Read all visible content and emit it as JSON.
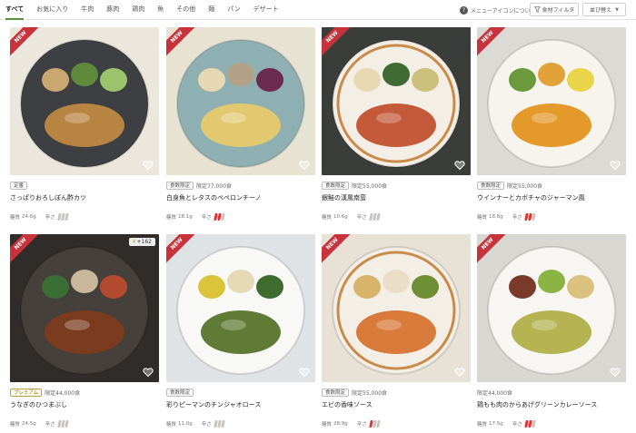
{
  "filters": {
    "tabs": [
      "すべて",
      "お気に入り",
      "牛肉",
      "豚肉",
      "鶏肉",
      "魚",
      "その他",
      "麺",
      "パン",
      "デザート"
    ],
    "active_tab": "すべて",
    "help_text": "メニューアイコンについて",
    "filter_button": "食材フィルタ",
    "sort_button": "並び替え"
  },
  "labels": {
    "carb_prefix": "糖質",
    "spice_label": "辛さ",
    "new_ribbon": "NEW"
  },
  "products": [
    {
      "name": "さっぱりおろしぽん酢カツ",
      "badge": "定番",
      "badge_type": "normal",
      "limit": "",
      "carbs": "24.6g",
      "spice_level": 0,
      "is_new": true,
      "price": "",
      "bg": "#ece7dc",
      "plate": "#3d3f42"
    },
    {
      "name": "白身魚とレタスのペペロンチーノ",
      "badge": "食数限定",
      "badge_type": "normal",
      "limit": "限定77,000食",
      "carbs": "18.1g",
      "spice_level": 2,
      "is_new": true,
      "price": "",
      "bg": "#e8e2d3",
      "plate": "#8fb0b2"
    },
    {
      "name": "銀鮭の漢風南蛮",
      "badge": "食数限定",
      "badge_type": "normal",
      "limit": "限定55,000食",
      "carbs": "10.6g",
      "spice_level": 0,
      "is_new": true,
      "price": "",
      "bg": "#3b3d3a",
      "plate": "#f3efe6"
    },
    {
      "name": "ウインナーとカボチャのジャーマン風",
      "badge": "食数限定",
      "badge_type": "normal",
      "limit": "限定55,000食",
      "carbs": "18.8g",
      "spice_level": 2,
      "is_new": true,
      "price": "",
      "bg": "#dbdad4",
      "plate": "#f6f4ec"
    },
    {
      "name": "うなぎのひつまぶし",
      "badge": "プレミアム",
      "badge_type": "premium",
      "limit": "限定44,000食",
      "carbs": "24.5g",
      "spice_level": 0,
      "is_new": true,
      "price": "+162",
      "bg": "#2f2c29",
      "plate": "#45403b"
    },
    {
      "name": "彩りピーマンのチンジャオロース",
      "badge": "食数限定",
      "badge_type": "normal",
      "limit": "",
      "carbs": "11.0g",
      "spice_level": 0,
      "is_new": true,
      "price": "",
      "bg": "#dfe3e6",
      "plate": "#f8f8f6"
    },
    {
      "name": "エビの香味ソース",
      "badge": "食数限定",
      "badge_type": "normal",
      "limit": "限定55,000食",
      "carbs": "28.9g",
      "spice_level": 1,
      "is_new": true,
      "price": "",
      "bg": "#e7e1d6",
      "plate": "#f3efe6"
    },
    {
      "name": "鶏もも肉のからあげグリーンカレーソース",
      "badge": "",
      "badge_type": "normal",
      "limit": "限定44,000食",
      "carbs": "17.5g",
      "spice_level": 2,
      "is_new": true,
      "price": "",
      "bg": "#d9d7d2",
      "plate": "#f7f6f2"
    }
  ]
}
